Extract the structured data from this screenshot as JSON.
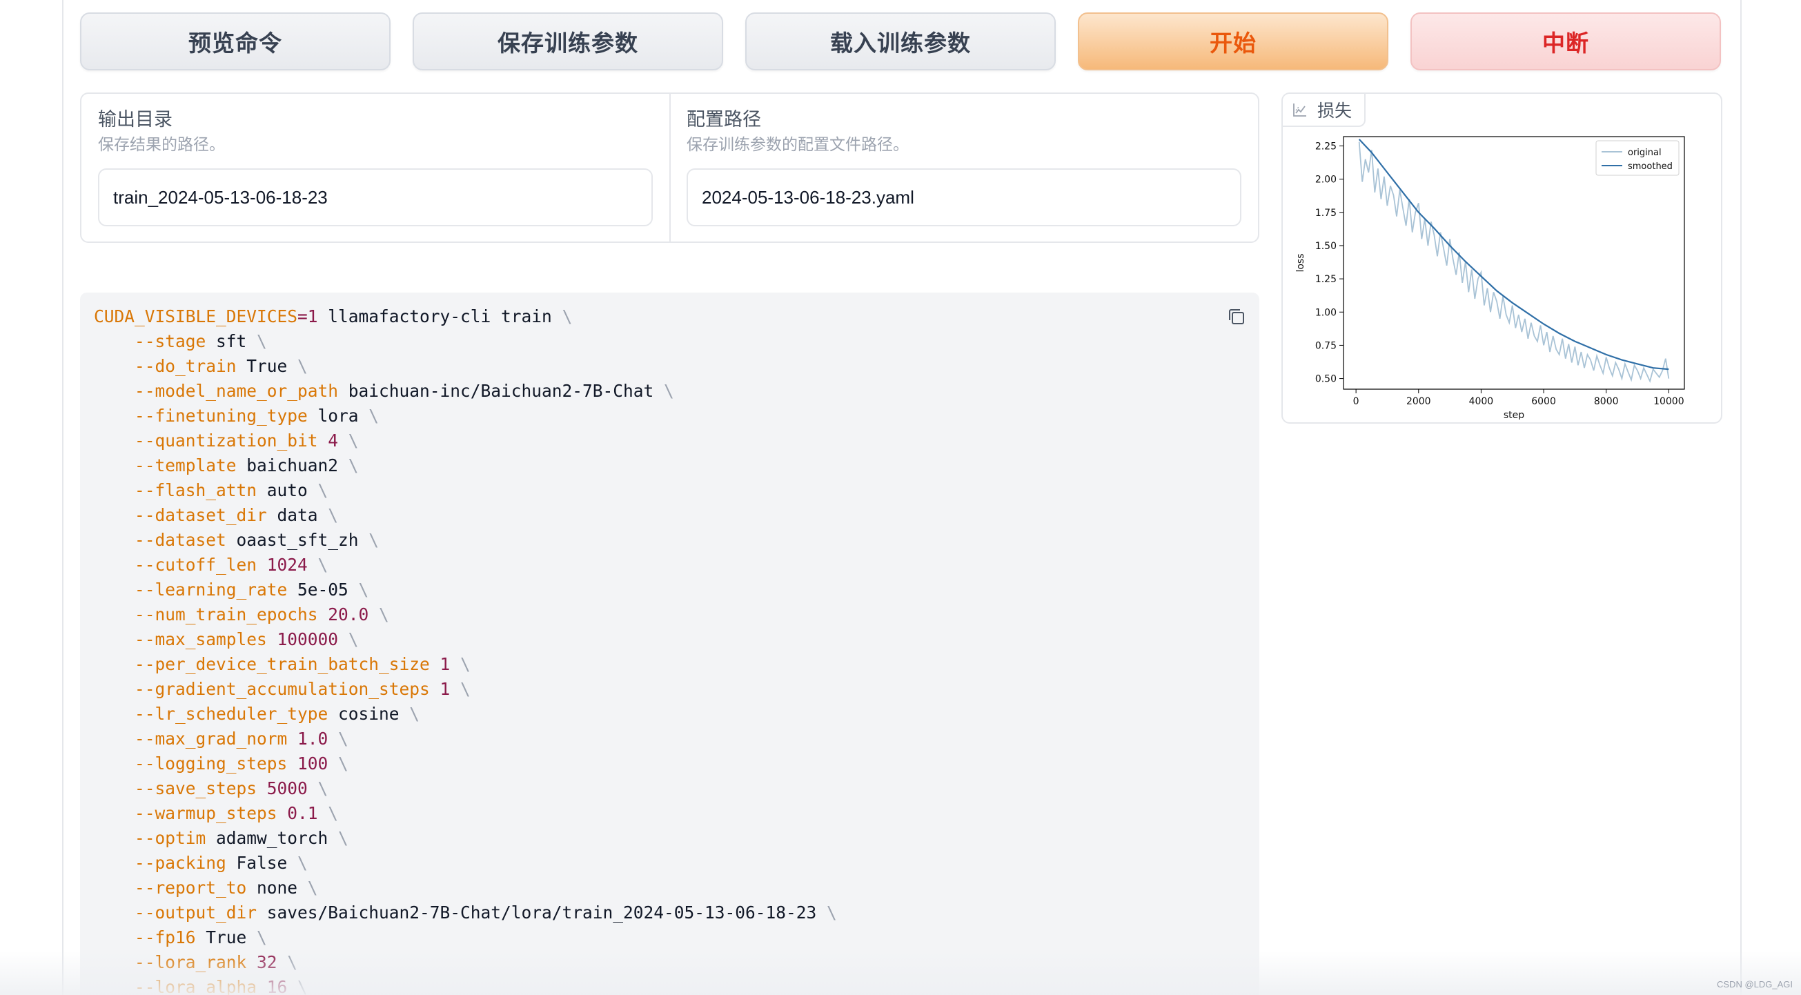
{
  "buttons": {
    "preview": "预览命令",
    "save_args": "保存训练参数",
    "load_args": "载入训练参数",
    "start": "开始",
    "abort": "中断"
  },
  "output_dir": {
    "label": "输出目录",
    "hint": "保存结果的路径。",
    "value": "train_2024-05-13-06-18-23"
  },
  "config_path": {
    "label": "配置路径",
    "hint": "保存训练参数的配置文件路径。",
    "value": "2024-05-13-06-18-23.yaml"
  },
  "loss_panel": {
    "tab_label": "损失",
    "icon": "line-chart-icon"
  },
  "chart_data": {
    "type": "line",
    "title": "",
    "xlabel": "step",
    "ylabel": "loss",
    "xlim": [
      -400,
      10500
    ],
    "ylim": [
      0.42,
      2.32
    ],
    "xticks": [
      0,
      2000,
      4000,
      6000,
      8000,
      10000
    ],
    "yticks": [
      0.5,
      0.75,
      1.0,
      1.25,
      1.5,
      1.75,
      2.0,
      2.25
    ],
    "legend_position": "top-right",
    "series": [
      {
        "name": "original",
        "color": "#a9c3d6",
        "x": [
          100,
          200,
          300,
          400,
          500,
          600,
          700,
          800,
          900,
          1000,
          1100,
          1200,
          1300,
          1400,
          1500,
          1600,
          1700,
          1800,
          1900,
          2000,
          2100,
          2200,
          2300,
          2400,
          2500,
          2600,
          2700,
          2800,
          2900,
          3000,
          3100,
          3200,
          3300,
          3400,
          3500,
          3600,
          3700,
          3800,
          3900,
          4000,
          4100,
          4200,
          4300,
          4400,
          4500,
          4600,
          4700,
          4800,
          4900,
          5000,
          5100,
          5200,
          5300,
          5400,
          5500,
          5600,
          5700,
          5800,
          5900,
          6000,
          6100,
          6200,
          6300,
          6400,
          6500,
          6600,
          6700,
          6800,
          6900,
          7000,
          7100,
          7200,
          7300,
          7400,
          7500,
          7600,
          7700,
          7800,
          7900,
          8000,
          8100,
          8200,
          8300,
          8400,
          8500,
          8600,
          8700,
          8800,
          8900,
          9000,
          9100,
          9200,
          9300,
          9400,
          9500,
          9600,
          9700,
          9800,
          9900,
          10000
        ],
        "values": [
          2.28,
          1.98,
          2.15,
          2.05,
          2.22,
          1.9,
          2.08,
          1.85,
          2.02,
          1.8,
          1.95,
          1.88,
          1.72,
          1.92,
          1.78,
          1.65,
          1.85,
          1.6,
          1.75,
          1.82,
          1.55,
          1.7,
          1.5,
          1.68,
          1.58,
          1.42,
          1.6,
          1.48,
          1.35,
          1.55,
          1.4,
          1.28,
          1.45,
          1.22,
          1.38,
          1.15,
          1.32,
          1.1,
          1.25,
          1.3,
          1.05,
          1.18,
          1.0,
          1.15,
          1.08,
          0.95,
          1.12,
          0.98,
          0.92,
          1.05,
          0.88,
          0.98,
          0.85,
          0.95,
          0.8,
          0.92,
          0.82,
          0.78,
          0.9,
          0.75,
          0.85,
          0.7,
          0.82,
          0.72,
          0.68,
          0.8,
          0.65,
          0.76,
          0.62,
          0.74,
          0.6,
          0.7,
          0.58,
          0.68,
          0.64,
          0.56,
          0.67,
          0.6,
          0.54,
          0.66,
          0.58,
          0.52,
          0.62,
          0.57,
          0.5,
          0.61,
          0.55,
          0.49,
          0.6,
          0.56,
          0.5,
          0.58,
          0.53,
          0.48,
          0.57,
          0.54,
          0.51,
          0.56,
          0.65,
          0.5
        ]
      },
      {
        "name": "smoothed",
        "color": "#2f6fa7",
        "x": [
          100,
          500,
          1000,
          1500,
          2000,
          2500,
          3000,
          3500,
          4000,
          4500,
          5000,
          5500,
          6000,
          6500,
          7000,
          7500,
          8000,
          8500,
          9000,
          9500,
          10000
        ],
        "values": [
          2.3,
          2.2,
          2.05,
          1.9,
          1.75,
          1.63,
          1.5,
          1.38,
          1.27,
          1.16,
          1.07,
          0.99,
          0.91,
          0.84,
          0.78,
          0.73,
          0.68,
          0.64,
          0.61,
          0.58,
          0.57
        ]
      }
    ]
  },
  "code": {
    "copy_icon": "copy-icon",
    "lines": [
      [
        {
          "t": "CUDA_VISIBLE_DEVICES",
          "c": "flag"
        },
        {
          "t": "=",
          "c": "num"
        },
        {
          "t": "1",
          "c": "num"
        },
        {
          "t": " llamafactory-cli train ",
          "c": "plain"
        },
        {
          "t": "\\",
          "c": "bs"
        }
      ],
      [
        {
          "t": "    --stage",
          "c": "flag"
        },
        {
          "t": " sft ",
          "c": "plain"
        },
        {
          "t": "\\",
          "c": "bs"
        }
      ],
      [
        {
          "t": "    --do_train",
          "c": "flag"
        },
        {
          "t": " True ",
          "c": "plain"
        },
        {
          "t": "\\",
          "c": "bs"
        }
      ],
      [
        {
          "t": "    --model_name_or_path",
          "c": "flag"
        },
        {
          "t": " baichuan-inc/Baichuan2-7B-Chat ",
          "c": "plain"
        },
        {
          "t": "\\",
          "c": "bs"
        }
      ],
      [
        {
          "t": "    --finetuning_type",
          "c": "flag"
        },
        {
          "t": " lora ",
          "c": "plain"
        },
        {
          "t": "\\",
          "c": "bs"
        }
      ],
      [
        {
          "t": "    --quantization_bit",
          "c": "flag"
        },
        {
          "t": " 4 ",
          "c": "num"
        },
        {
          "t": "\\",
          "c": "bs"
        }
      ],
      [
        {
          "t": "    --template",
          "c": "flag"
        },
        {
          "t": " baichuan2 ",
          "c": "plain"
        },
        {
          "t": "\\",
          "c": "bs"
        }
      ],
      [
        {
          "t": "    --flash_attn",
          "c": "flag"
        },
        {
          "t": " auto ",
          "c": "plain"
        },
        {
          "t": "\\",
          "c": "bs"
        }
      ],
      [
        {
          "t": "    --dataset_dir",
          "c": "flag"
        },
        {
          "t": " data ",
          "c": "plain"
        },
        {
          "t": "\\",
          "c": "bs"
        }
      ],
      [
        {
          "t": "    --dataset",
          "c": "flag"
        },
        {
          "t": " oaast_sft_zh ",
          "c": "plain"
        },
        {
          "t": "\\",
          "c": "bs"
        }
      ],
      [
        {
          "t": "    --cutoff_len",
          "c": "flag"
        },
        {
          "t": " 1024 ",
          "c": "num"
        },
        {
          "t": "\\",
          "c": "bs"
        }
      ],
      [
        {
          "t": "    --learning_rate",
          "c": "flag"
        },
        {
          "t": " 5e-05 ",
          "c": "plain"
        },
        {
          "t": "\\",
          "c": "bs"
        }
      ],
      [
        {
          "t": "    --num_train_epochs",
          "c": "flag"
        },
        {
          "t": " 20.0 ",
          "c": "num"
        },
        {
          "t": "\\",
          "c": "bs"
        }
      ],
      [
        {
          "t": "    --max_samples",
          "c": "flag"
        },
        {
          "t": " 100000 ",
          "c": "num"
        },
        {
          "t": "\\",
          "c": "bs"
        }
      ],
      [
        {
          "t": "    --per_device_train_batch_size",
          "c": "flag"
        },
        {
          "t": " 1 ",
          "c": "num"
        },
        {
          "t": "\\",
          "c": "bs"
        }
      ],
      [
        {
          "t": "    --gradient_accumulation_steps",
          "c": "flag"
        },
        {
          "t": " 1 ",
          "c": "num"
        },
        {
          "t": "\\",
          "c": "bs"
        }
      ],
      [
        {
          "t": "    --lr_scheduler_type",
          "c": "flag"
        },
        {
          "t": " cosine ",
          "c": "plain"
        },
        {
          "t": "\\",
          "c": "bs"
        }
      ],
      [
        {
          "t": "    --max_grad_norm",
          "c": "flag"
        },
        {
          "t": " 1.0 ",
          "c": "num"
        },
        {
          "t": "\\",
          "c": "bs"
        }
      ],
      [
        {
          "t": "    --logging_steps",
          "c": "flag"
        },
        {
          "t": " 100 ",
          "c": "num"
        },
        {
          "t": "\\",
          "c": "bs"
        }
      ],
      [
        {
          "t": "    --save_steps",
          "c": "flag"
        },
        {
          "t": " 5000 ",
          "c": "num"
        },
        {
          "t": "\\",
          "c": "bs"
        }
      ],
      [
        {
          "t": "    --warmup_steps",
          "c": "flag"
        },
        {
          "t": " 0.1 ",
          "c": "num"
        },
        {
          "t": "\\",
          "c": "bs"
        }
      ],
      [
        {
          "t": "    --optim",
          "c": "flag"
        },
        {
          "t": " adamw_torch ",
          "c": "plain"
        },
        {
          "t": "\\",
          "c": "bs"
        }
      ],
      [
        {
          "t": "    --packing",
          "c": "flag"
        },
        {
          "t": " False ",
          "c": "plain"
        },
        {
          "t": "\\",
          "c": "bs"
        }
      ],
      [
        {
          "t": "    --report_to",
          "c": "flag"
        },
        {
          "t": " none ",
          "c": "plain"
        },
        {
          "t": "\\",
          "c": "bs"
        }
      ],
      [
        {
          "t": "    --output_dir",
          "c": "flag"
        },
        {
          "t": " saves/Baichuan2-7B-Chat/lora/train_2024-05-13-06-18-23 ",
          "c": "plain"
        },
        {
          "t": "\\",
          "c": "bs"
        }
      ],
      [
        {
          "t": "    --fp16",
          "c": "flag"
        },
        {
          "t": " True ",
          "c": "plain"
        },
        {
          "t": "\\",
          "c": "bs"
        }
      ],
      [
        {
          "t": "    --lora_rank",
          "c": "flag"
        },
        {
          "t": " 32 ",
          "c": "num"
        },
        {
          "t": "\\",
          "c": "bs"
        }
      ],
      [
        {
          "t": "    --lora_alpha",
          "c": "flag"
        },
        {
          "t": " 16 ",
          "c": "num"
        },
        {
          "t": "\\",
          "c": "bs"
        }
      ]
    ]
  },
  "watermark": "CSDN @LDG_AGI"
}
